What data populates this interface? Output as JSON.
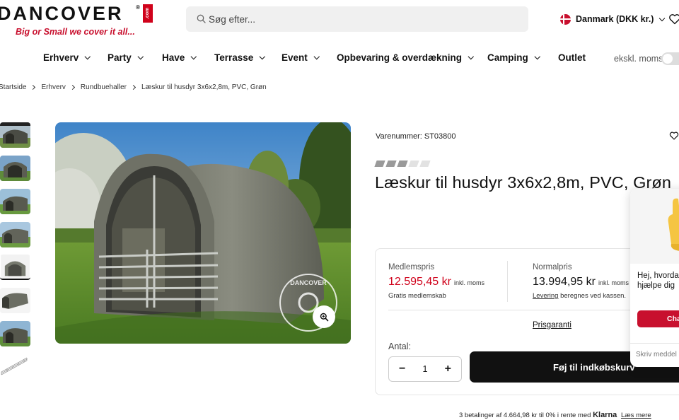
{
  "header": {
    "logo_text": "DANCOVER",
    "logo_reg": "®",
    "logo_com": ".com",
    "tagline": "Big or Small we cover it all...",
    "search_placeholder": "Søg efter...",
    "country": "Danmark (DKK kr.)"
  },
  "nav": {
    "items": [
      {
        "label": "Erhverv",
        "has_dropdown": true
      },
      {
        "label": "Party",
        "has_dropdown": true
      },
      {
        "label": "Have",
        "has_dropdown": true
      },
      {
        "label": "Terrasse",
        "has_dropdown": true
      },
      {
        "label": "Event",
        "has_dropdown": true
      },
      {
        "label": "Opbevaring & overdækning",
        "has_dropdown": true
      },
      {
        "label": "Camping",
        "has_dropdown": true
      },
      {
        "label": "Outlet",
        "has_dropdown": false
      }
    ],
    "vat_toggle_label": "ekskl. moms"
  },
  "breadcrumb": [
    "Startside",
    "Erhverv",
    "Rundbuehaller",
    "Læskur til husdyr 3x6x2,8m, PVC, Grøn"
  ],
  "product": {
    "sku": "Varenummer: ST03800",
    "title": "Læskur til husdyr 3x6x2,8m, PVC, Grøn",
    "rating_filled": 3,
    "rating_max": 5,
    "member_price_label": "Medlemspris",
    "member_price": "12.595,45 kr",
    "member_price_suffix": "inkl. moms",
    "member_note": "Gratis medlemskab",
    "normal_price_label": "Normalpris",
    "normal_price": "13.994,95 kr",
    "normal_price_suffix": "inkl. moms",
    "delivery_link": "Levering",
    "delivery_note": "beregnes ved kassen.",
    "guarantee": "Prisgaranti",
    "quantity_label": "Antal:",
    "quantity": "1",
    "qty_minus": "−",
    "qty_plus": "+",
    "add_to_cart": "Føj til indkøbskurv",
    "klarna_text": "3 betalinger af 4.664,98 kr til 0% i rente med",
    "klarna_brand": "Klarna",
    "klarna_link": "Læs mere",
    "watermark": "DANCOVER"
  },
  "chat": {
    "greeting_line1": "Hej, hvorda",
    "greeting_line2": "hjælpe dig",
    "button": "Cha",
    "input_placeholder": "Skriv meddel"
  },
  "colors": {
    "brand_red": "#c8102e",
    "price_red": "#d0021b",
    "dark": "#111111"
  }
}
